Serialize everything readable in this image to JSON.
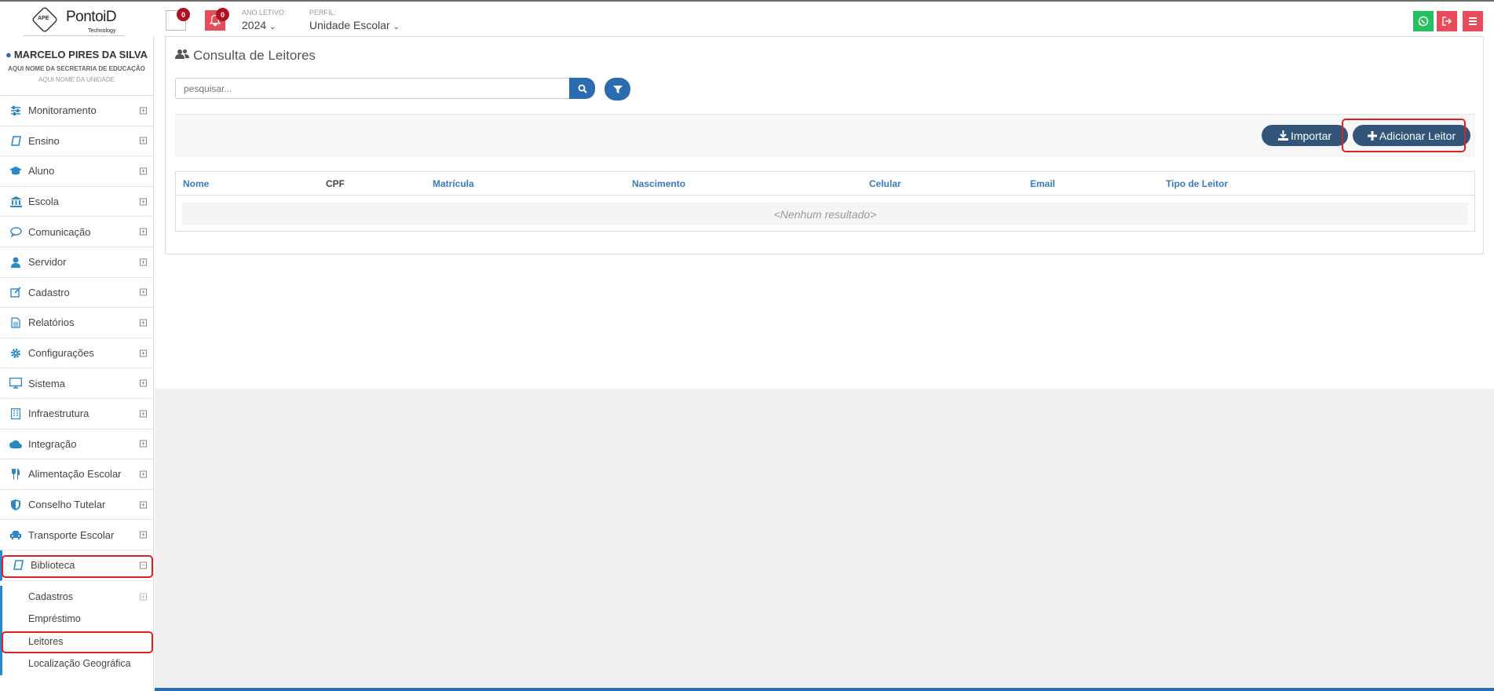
{
  "header": {
    "logo_brand": "PontoiD",
    "logo_badge": "APE",
    "logo_sub": "Technology",
    "notifications_count": "0",
    "alerts_count": "0",
    "ano_letivo_label": "ANO LETIVO:",
    "ano_letivo_value": "2024",
    "perfil_label": "PERFIL:",
    "perfil_value": "Unidade Escolar"
  },
  "user": {
    "name": "MARCELO PIRES DA SILVA",
    "secretaria": "AQUI NOME DA SECRETARIA DE EDUCAÇÃO",
    "unidade": "AQUI NOME DA UNIDADE"
  },
  "sidebar": {
    "items": [
      {
        "label": "Monitoramento",
        "icon": "sliders-icon"
      },
      {
        "label": "Ensino",
        "icon": "book-icon"
      },
      {
        "label": "Aluno",
        "icon": "graduation-cap-icon"
      },
      {
        "label": "Escola",
        "icon": "institution-icon"
      },
      {
        "label": "Comunicação",
        "icon": "comment-icon"
      },
      {
        "label": "Servidor",
        "icon": "user-icon"
      },
      {
        "label": "Cadastro",
        "icon": "edit-icon"
      },
      {
        "label": "Relatórios",
        "icon": "file-text-icon"
      },
      {
        "label": "Configurações",
        "icon": "cog-icon"
      },
      {
        "label": "Sistema",
        "icon": "desktop-icon"
      },
      {
        "label": "Infraestrutura",
        "icon": "building-icon"
      },
      {
        "label": "Integração",
        "icon": "cloud-icon"
      },
      {
        "label": "Alimentação Escolar",
        "icon": "cutlery-icon"
      },
      {
        "label": "Conselho Tutelar",
        "icon": "shield-icon"
      },
      {
        "label": "Transporte Escolar",
        "icon": "car-icon"
      },
      {
        "label": "Biblioteca",
        "icon": "book-icon"
      }
    ],
    "sub_items": [
      "Cadastros",
      "Empréstimo",
      "Leitores",
      "Localização Geográfica"
    ]
  },
  "main": {
    "title": "Consulta de Leitores",
    "search_placeholder": "pesquisar...",
    "import_label": "Importar",
    "add_label": "Adicionar Leitor",
    "columns": [
      "Nome",
      "CPF",
      "Matrícula",
      "Nascimento",
      "Celular",
      "Email",
      "Tipo de Leitor"
    ],
    "empty_text": "<Nenhum resultado>"
  },
  "colors": {
    "accent": "#2b6cb0",
    "button": "#34557a",
    "danger": "#e84c5a",
    "whatsapp": "#24c15e",
    "highlight": "#e02020"
  }
}
